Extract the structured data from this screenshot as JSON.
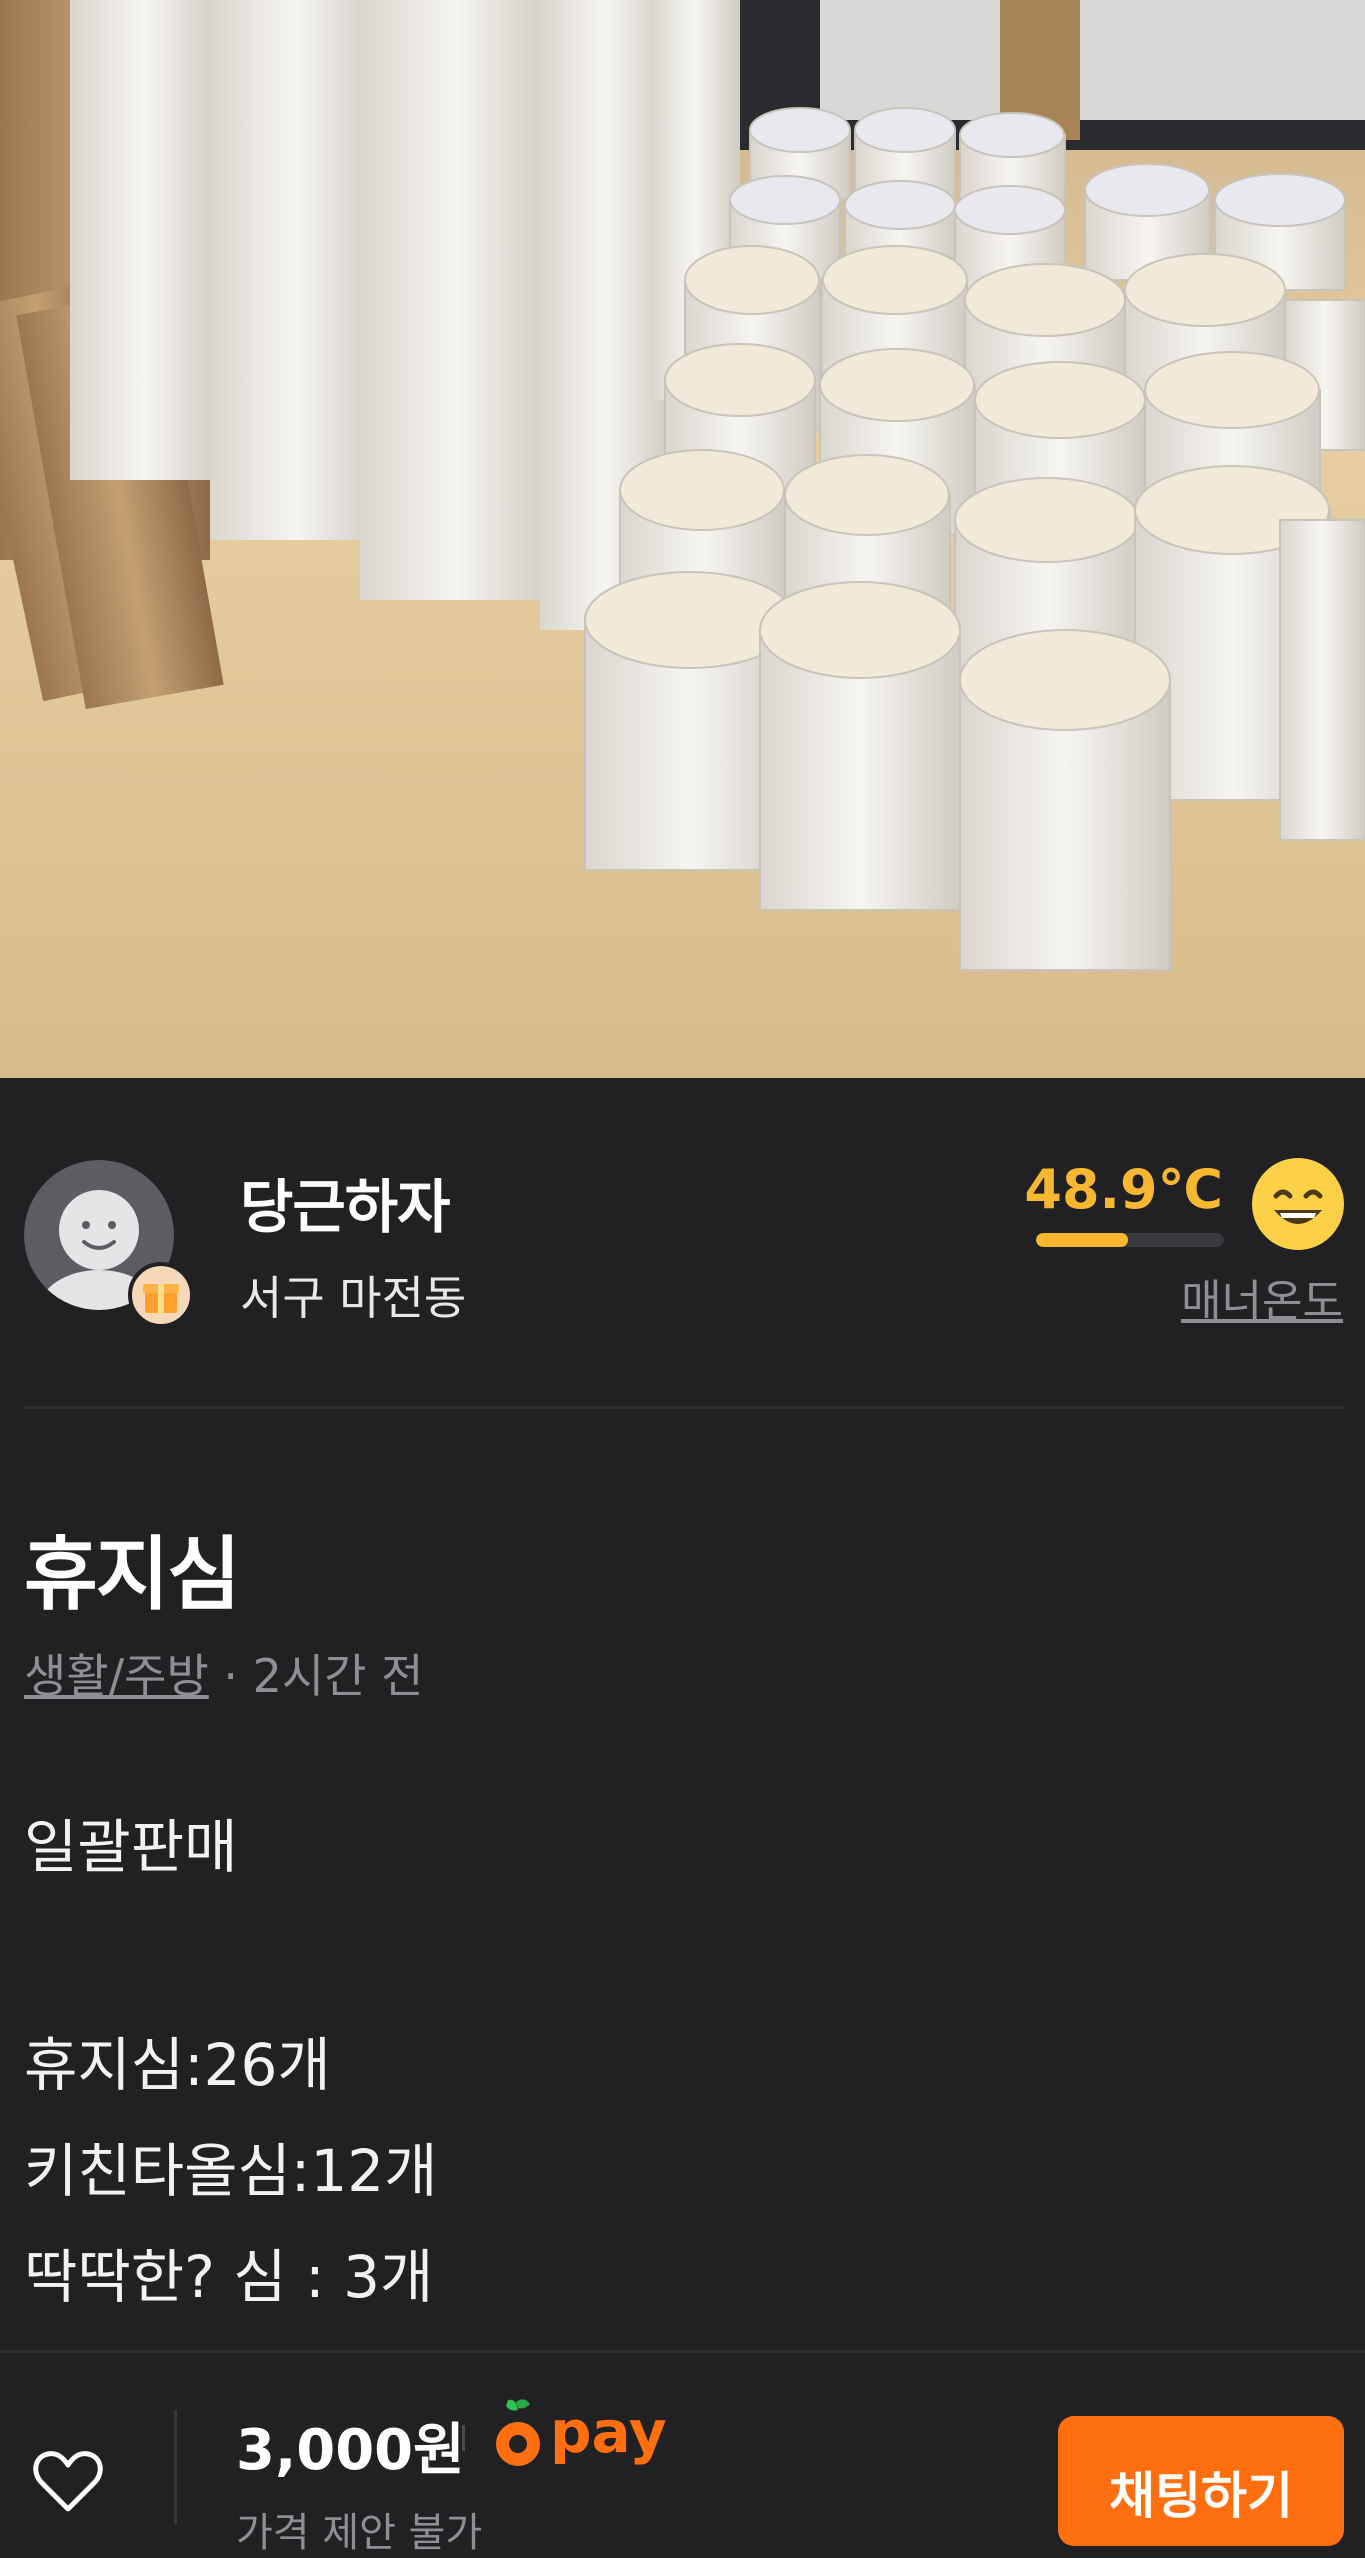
{
  "listing_photo": {
    "alt": "listing-photo"
  },
  "seller": {
    "nickname": "당근하자",
    "location": "서구 마전동",
    "manner_temp": "48.9℃",
    "manner_label": "매너온도",
    "manner_level_percent": 48.9
  },
  "item": {
    "title": "휴지심",
    "category": "생활/주방",
    "time_sep": " · ",
    "time": "2시간 전",
    "description": [
      "일괄판매",
      "",
      "휴지심:26개",
      "키친타올심:12개",
      "딱딱한? 심 : 3개"
    ]
  },
  "bottom_bar": {
    "price": "3,000원",
    "pay_label": "pay",
    "sub_text": "가격 제안 불가",
    "chat_button": "채팅하기"
  },
  "colors": {
    "accent": "#ff6f0f",
    "temp": "#f7b731",
    "background": "#212124"
  }
}
